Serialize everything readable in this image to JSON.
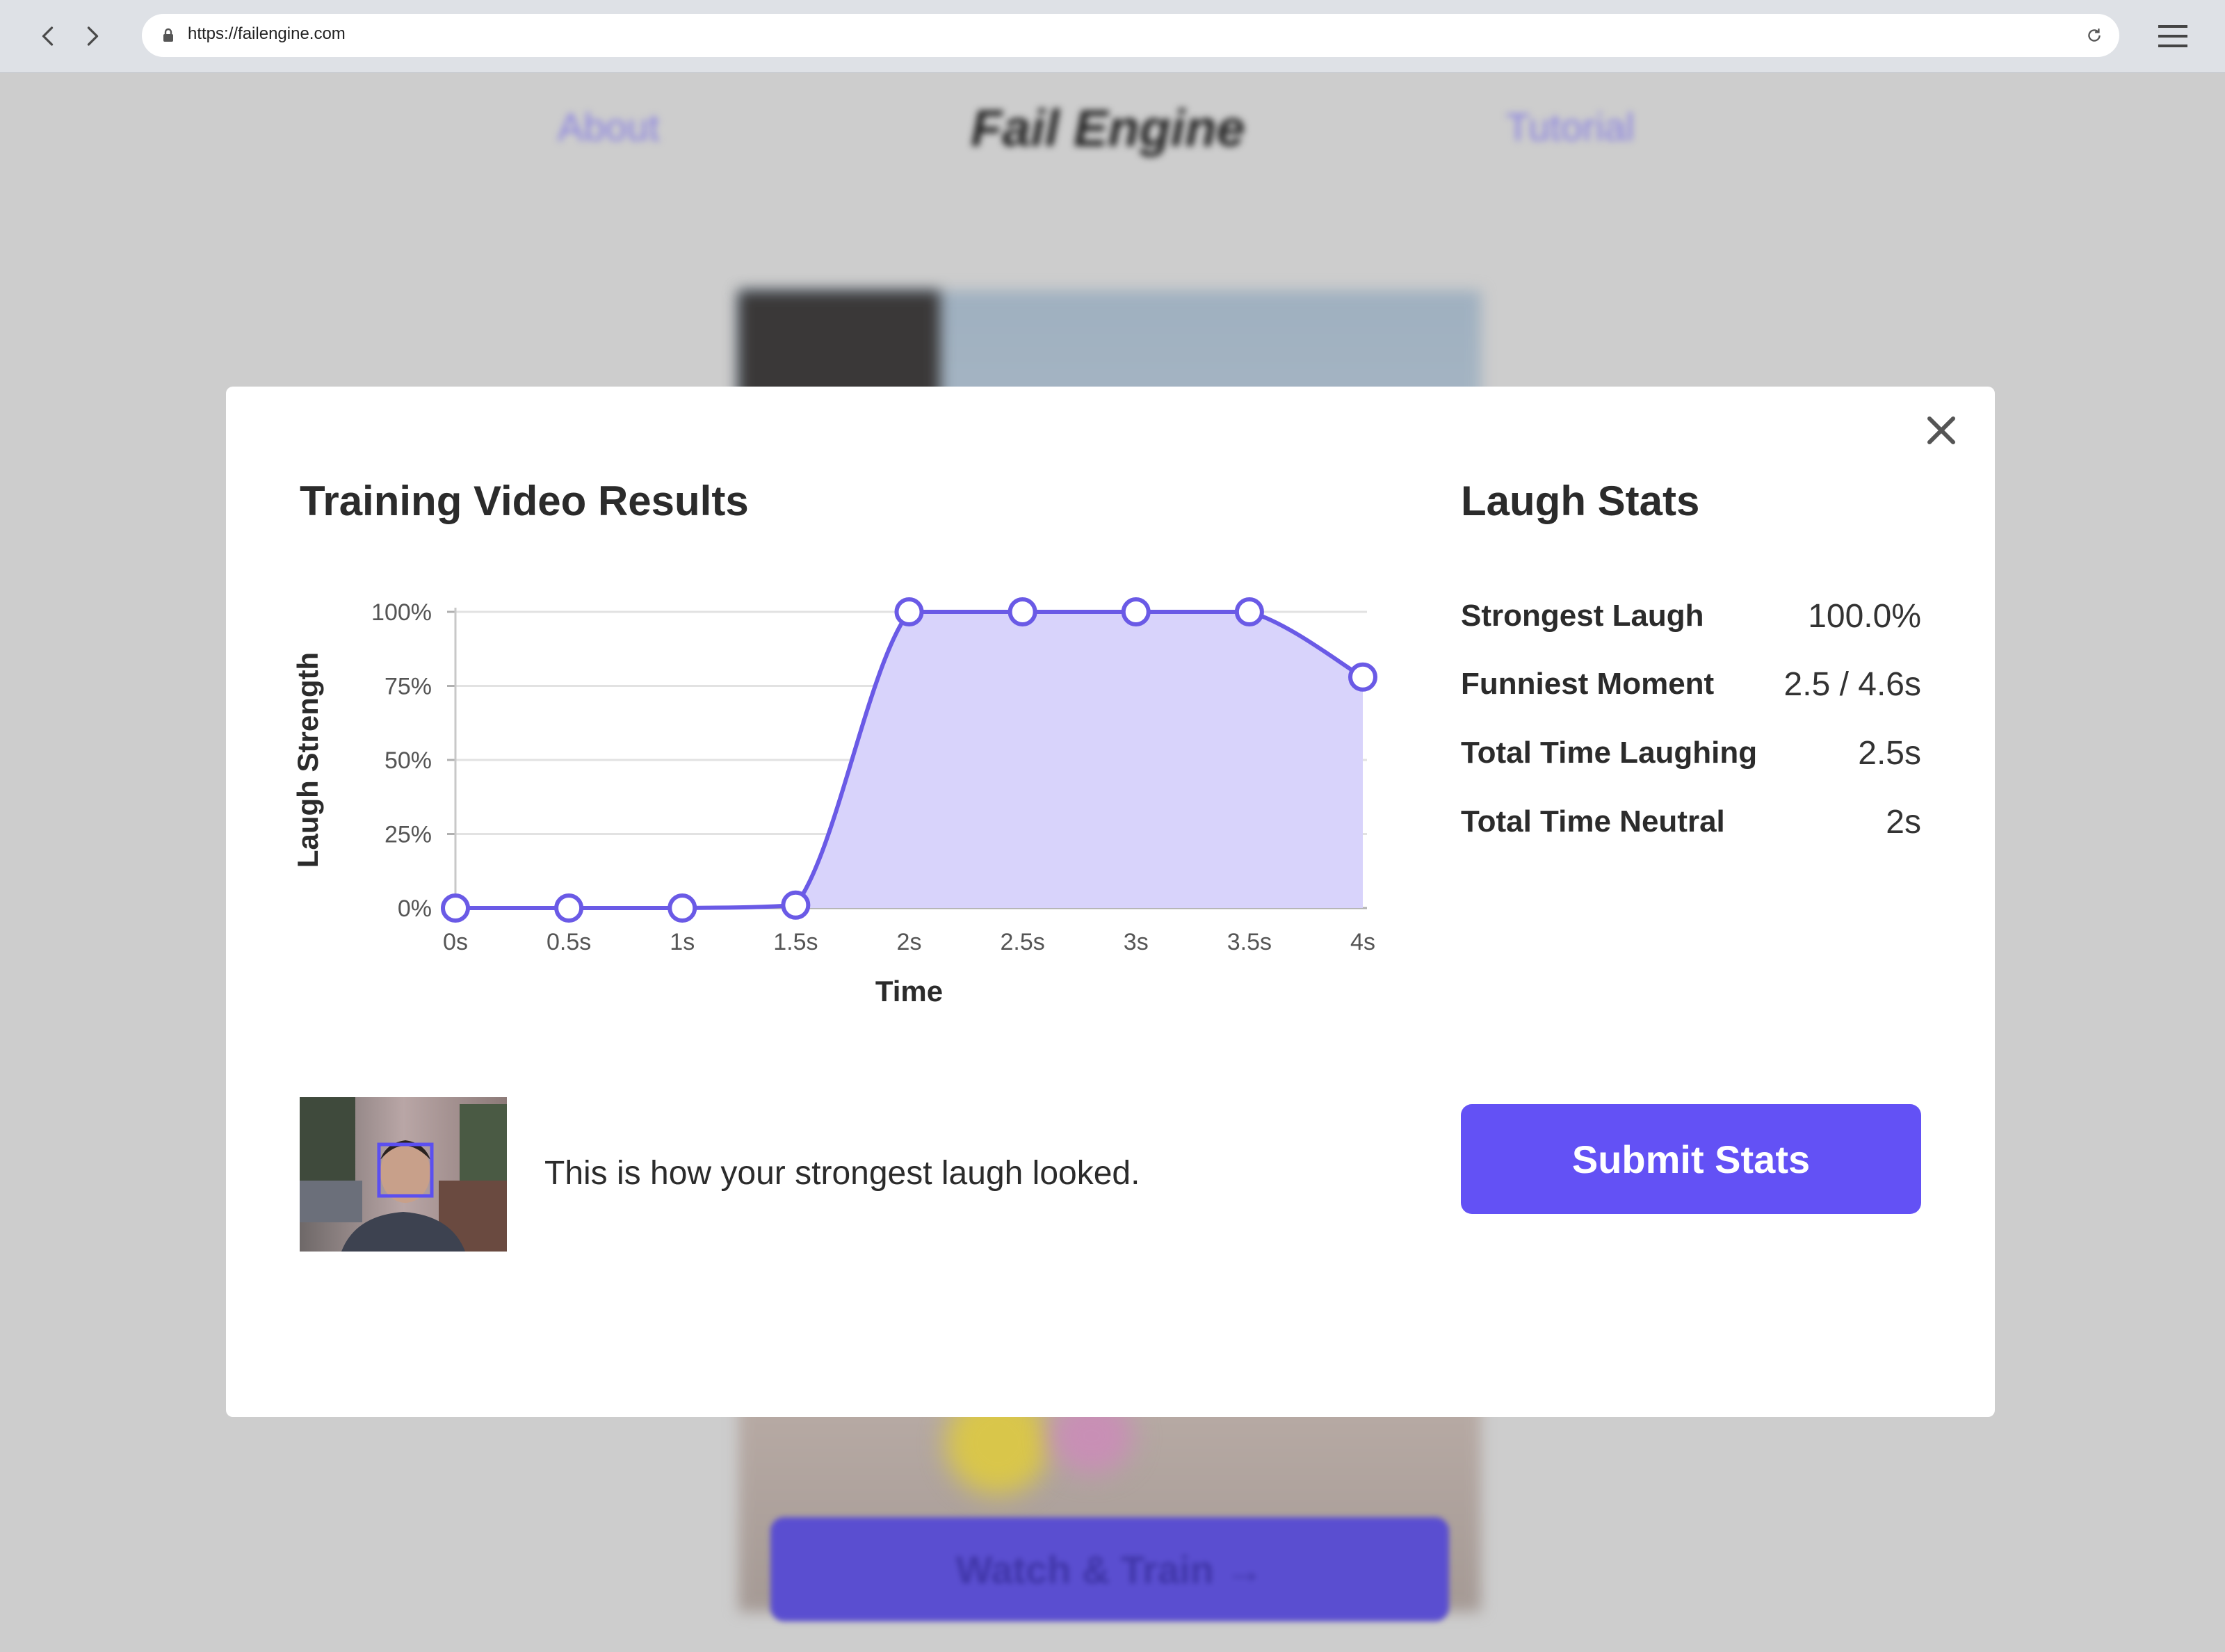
{
  "browser": {
    "url": "https://failengine.com"
  },
  "background_page": {
    "nav_about": "About",
    "logo": "Fail Engine",
    "nav_tutorial": "Tutorial",
    "watch_button": "Watch & Train →"
  },
  "modal": {
    "title": "Training Video Results",
    "stats_title": "Laugh Stats",
    "stats": [
      {
        "label": "Strongest Laugh",
        "value": "100.0%"
      },
      {
        "label": "Funniest Moment",
        "value": "2.5 / 4.6s"
      },
      {
        "label": "Total Time Laughing",
        "value": "2.5s"
      },
      {
        "label": "Total Time Neutral",
        "value": "2s"
      }
    ],
    "thumbnail_caption": "This is how your strongest laugh looked.",
    "submit_label": "Submit Stats"
  },
  "chart_data": {
    "type": "area",
    "xlabel": "Time",
    "ylabel": "Laugh Strength",
    "x": [
      0,
      0.5,
      1,
      1.5,
      2,
      2.5,
      3,
      3.5,
      4
    ],
    "x_tick_labels": [
      "0s",
      "0.5s",
      "1s",
      "1.5s",
      "2s",
      "2.5s",
      "3s",
      "3.5s",
      "4s"
    ],
    "y_tick_labels": [
      "0%",
      "25%",
      "50%",
      "75%",
      "100%"
    ],
    "y_ticks": [
      0,
      25,
      50,
      75,
      100
    ],
    "series": [
      {
        "values": [
          0,
          0,
          0,
          1,
          100,
          100,
          100,
          100,
          78
        ]
      }
    ],
    "xlim": [
      0,
      4
    ],
    "ylim": [
      0,
      100
    ],
    "grid": true,
    "colors": {
      "line": "#6a5ae6",
      "fill": "#d8d3fb",
      "grid": "#e2e2e2"
    }
  }
}
